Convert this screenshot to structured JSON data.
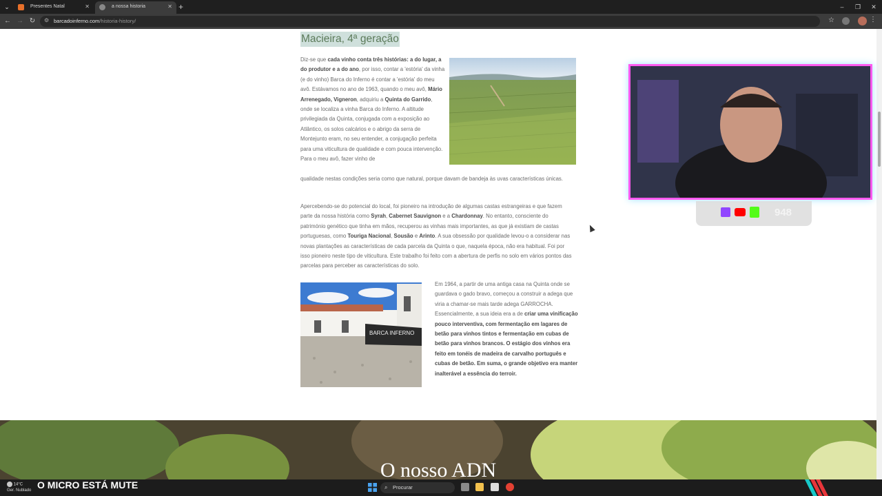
{
  "browser": {
    "tabs": [
      {
        "label": "Presentes Natal",
        "active": false
      },
      {
        "label": "a nossa historia",
        "active": true
      }
    ],
    "url_domain": "barcadoinferno.com",
    "url_path": "/historia-history/"
  },
  "article": {
    "heading": "Macieira, 4ª geração",
    "p1_segments": [
      {
        "t": "Diz-se que ",
        "b": false
      },
      {
        "t": "cada vinho conta três histórias: a do lugar, a do produtor e a do ano",
        "b": true
      },
      {
        "t": ", por isso, contar a 'estória' da vinha (e do vinho) Barca do Inferno é contar a 'estória' do meu avô. Estávamos no ano de 1963, quando o meu avô, ",
        "b": false
      },
      {
        "t": "Mário Arrenegado, Vigneron",
        "b": true
      },
      {
        "t": ", adquiriu a ",
        "b": false
      },
      {
        "t": "Quinta do Garrido",
        "b": true
      },
      {
        "t": ", onde se localiza a vinha Barca do Inferno. A altitude privilegiada da Quinta, conjugada com a exposição ao Atlântico, os solos calcários e o abrigo da serra de Montejunto eram, no seu entender, a conjugação perfeita para uma viticultura de qualidade e com pouca intervenção. Para o meu avô, fazer vinho de",
        "b": false
      }
    ],
    "p1_tail": "qualidade nestas condições seria como que natural, porque davam de bandeja às uvas características únicas.",
    "p2_segments": [
      {
        "t": "Apercebendo-se do potencial do local, foi pioneiro na introdução de algumas castas estrangeiras e que fazem parte da nossa história como ",
        "b": false
      },
      {
        "t": "Syrah",
        "b": true
      },
      {
        "t": ", ",
        "b": false
      },
      {
        "t": "Cabernet Sauvignon",
        "b": true
      },
      {
        "t": " e a ",
        "b": false
      },
      {
        "t": "Chardonnay",
        "b": true
      },
      {
        "t": ". No entanto, consciente do património genético que tinha em mãos, recuperou as vinhas mais importantes, as que já existiam de castas portuguesas, como ",
        "b": false
      },
      {
        "t": "Touriga Nacional",
        "b": true
      },
      {
        "t": ", ",
        "b": false
      },
      {
        "t": "Sousão",
        "b": true
      },
      {
        "t": " e ",
        "b": false
      },
      {
        "t": "Arinto",
        "b": true
      },
      {
        "t": ". A sua obsessão por qualidade levou-o a considerar nas novas plantações as características de cada parcela da Quinta o que, naquela época, não era habitual. Foi por isso pioneiro neste tipo de viticultura. Este trabalho foi feito com a abertura de perfis no solo em vários pontos das parcelas para perceber as características do solo.",
        "b": false
      }
    ],
    "p3_segments": [
      {
        "t": "Em 1964, a partir de uma antiga casa na Quinta onde se guardava o gado bravo, começou a construir a adega que viria a chamar-se mais tarde adega GARROCHA. Essencialmente, a sua ideia era a de ",
        "b": false
      },
      {
        "t": "criar uma vinificação pouco interventiva, com fermentação em lagares de betão para vinhos tintos e fermentação em cubas de betão para vinhos brancos. O estágio dos vinhos era feito em tonéis de madeira de carvalho português e cubas de betão. Em suma, o grande objetivo era manter inalterável a essência do terroir.",
        "b": true
      }
    ],
    "winery_sign": "BARCA INFERNO"
  },
  "banner": {
    "title": "O nosso ADN"
  },
  "stream": {
    "follower_count": "948",
    "overlay_text": "O MICRO ESTÁ MUTE"
  },
  "taskbar": {
    "temp": "14°C",
    "weather": "Ger. Nublado",
    "search_placeholder": "Procurar"
  },
  "colors": {
    "heading_highlight": "#cfe0dc",
    "heading_text": "#5b7a59",
    "webcam_border": "#ff5af0"
  }
}
